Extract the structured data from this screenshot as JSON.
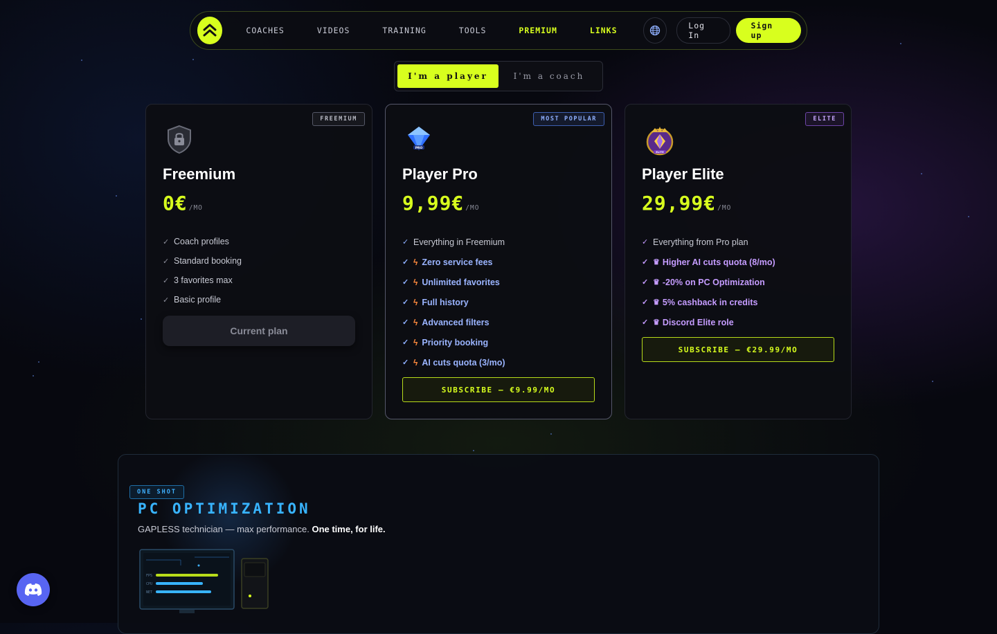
{
  "nav": {
    "links": [
      "COACHES",
      "VIDEOS",
      "TRAINING",
      "TOOLS",
      "PREMIUM",
      "LINKS"
    ],
    "login": "Log In",
    "signup": "Sign up"
  },
  "toggle": {
    "player": "I'm a player",
    "coach": "I'm a coach"
  },
  "plans": {
    "free": {
      "badge": "FREEMIUM",
      "name": "Freemium",
      "price": "0€",
      "unit": "/MO",
      "features": [
        "Coach profiles",
        "Standard booking",
        "3 favorites max",
        "Basic profile"
      ],
      "button": "Current plan"
    },
    "pro": {
      "badge": "MOST POPULAR",
      "name": "Player Pro",
      "price": "9,99€",
      "unit": "/MO",
      "base_feature": "Everything in Freemium",
      "features": [
        "Zero service fees",
        "Unlimited favorites",
        "Full history",
        "Advanced filters",
        "Priority booking",
        "AI cuts quota (3/mo)"
      ],
      "button": "SUBSCRIBE — €9.99/MO"
    },
    "elite": {
      "badge": "ELITE",
      "name": "Player Elite",
      "price": "29,99€",
      "unit": "/MO",
      "base_feature": "Everything from Pro plan",
      "features": [
        "Higher AI cuts quota (8/mo)",
        "-20% on PC Optimization",
        "5% cashback in credits",
        "Discord Elite role"
      ],
      "button": "SUBSCRIBE — €29.99/MO"
    }
  },
  "pc_opt": {
    "badge": "ONE SHOT",
    "title": "PC OPTIMIZATION",
    "desc_prefix": "GAPLESS technician — max performance. ",
    "desc_bold": "One time, for life.",
    "screen_labels": [
      "FPS",
      "CPU",
      "NET"
    ]
  },
  "colors": {
    "accent": "#d8ff1e",
    "pro": "#9ab4ff",
    "elite": "#c59cff",
    "pc": "#38b4ff",
    "discord": "#5865f2"
  }
}
